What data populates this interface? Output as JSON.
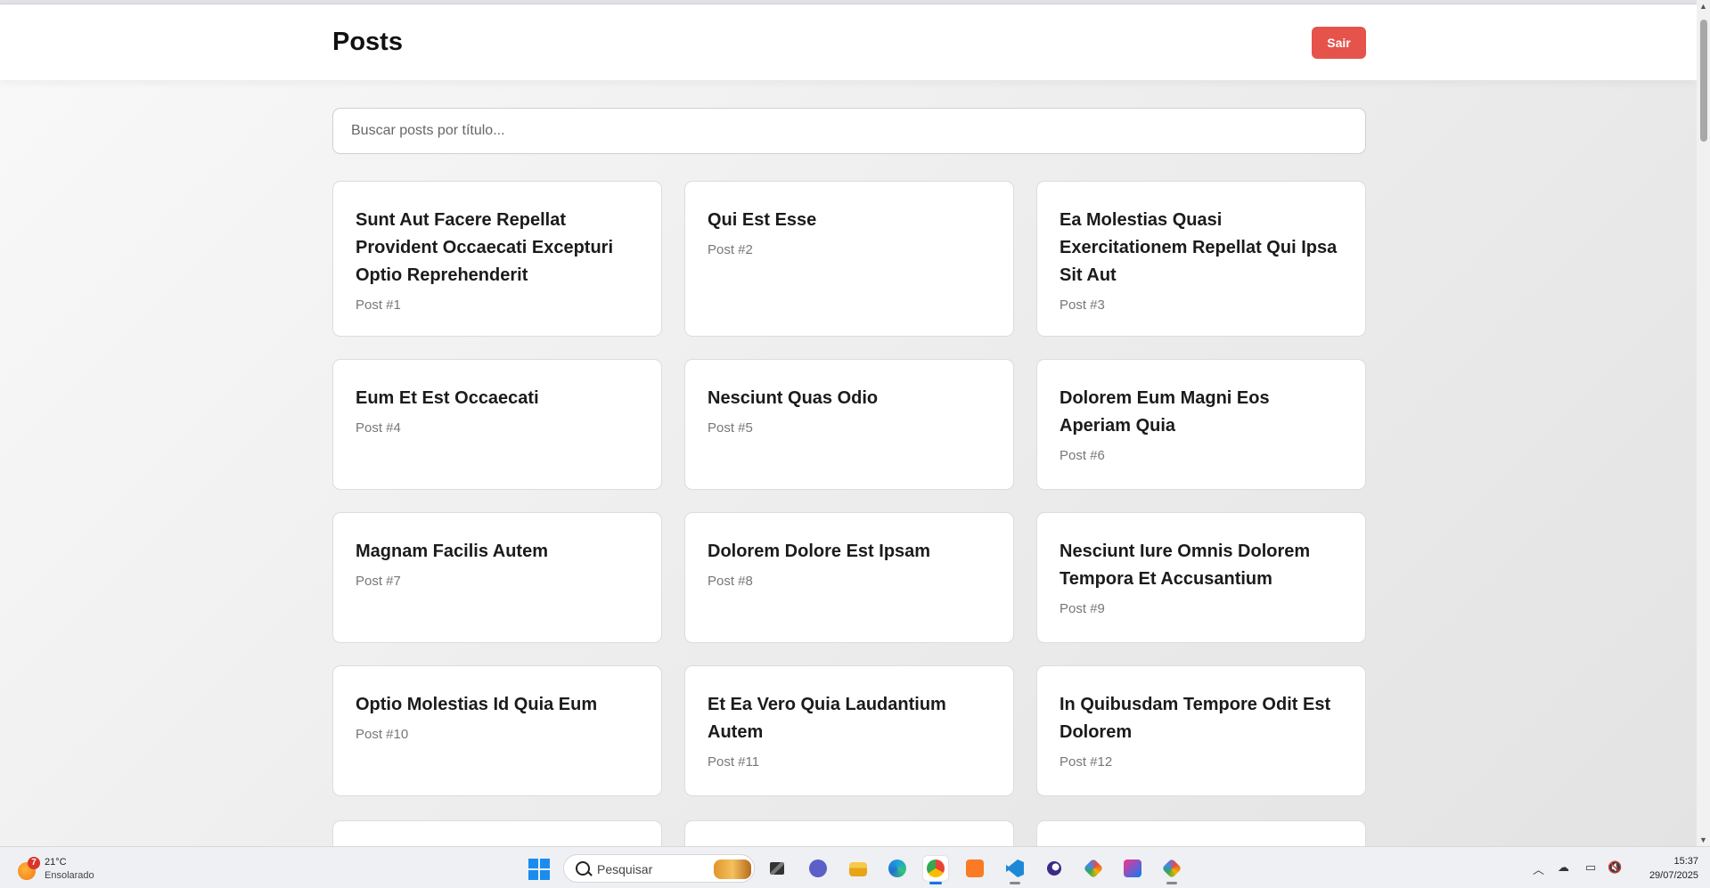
{
  "header": {
    "title": "Posts",
    "logout_label": "Sair"
  },
  "search": {
    "placeholder": "Buscar posts por título..."
  },
  "posts": [
    {
      "title": "Sunt Aut Facere Repellat Provident Occaecati Excepturi Optio Reprehenderit",
      "label": "Post #1"
    },
    {
      "title": "Qui Est Esse",
      "label": "Post #2"
    },
    {
      "title": "Ea Molestias Quasi Exercitationem Repellat Qui Ipsa Sit Aut",
      "label": "Post #3"
    },
    {
      "title": "Eum Et Est Occaecati",
      "label": "Post #4"
    },
    {
      "title": "Nesciunt Quas Odio",
      "label": "Post #5"
    },
    {
      "title": "Dolorem Eum Magni Eos Aperiam Quia",
      "label": "Post #6"
    },
    {
      "title": "Magnam Facilis Autem",
      "label": "Post #7"
    },
    {
      "title": "Dolorem Dolore Est Ipsam",
      "label": "Post #8"
    },
    {
      "title": "Nesciunt Iure Omnis Dolorem Tempora Et Accusantium",
      "label": "Post #9"
    },
    {
      "title": "Optio Molestias Id Quia Eum",
      "label": "Post #10"
    },
    {
      "title": "Et Ea Vero Quia Laudantium Autem",
      "label": "Post #11"
    },
    {
      "title": "In Quibusdam Tempore Odit Est Dolorem",
      "label": "Post #12"
    }
  ],
  "taskbar": {
    "weather": {
      "temp": "21°C",
      "desc": "Ensolarado",
      "badge": "7"
    },
    "search_label": "Pesquisar",
    "apps": [
      "task-view",
      "teams-chat",
      "file-explorer",
      "edge",
      "chrome",
      "xampp",
      "vscode",
      "eclipse",
      "git",
      "intellij",
      "git-gui"
    ],
    "time": "15:37",
    "date": "29/07/2025"
  },
  "colors": {
    "accent": "#e5534b",
    "card_border": "#dcdcdc",
    "muted_text": "#777777"
  }
}
